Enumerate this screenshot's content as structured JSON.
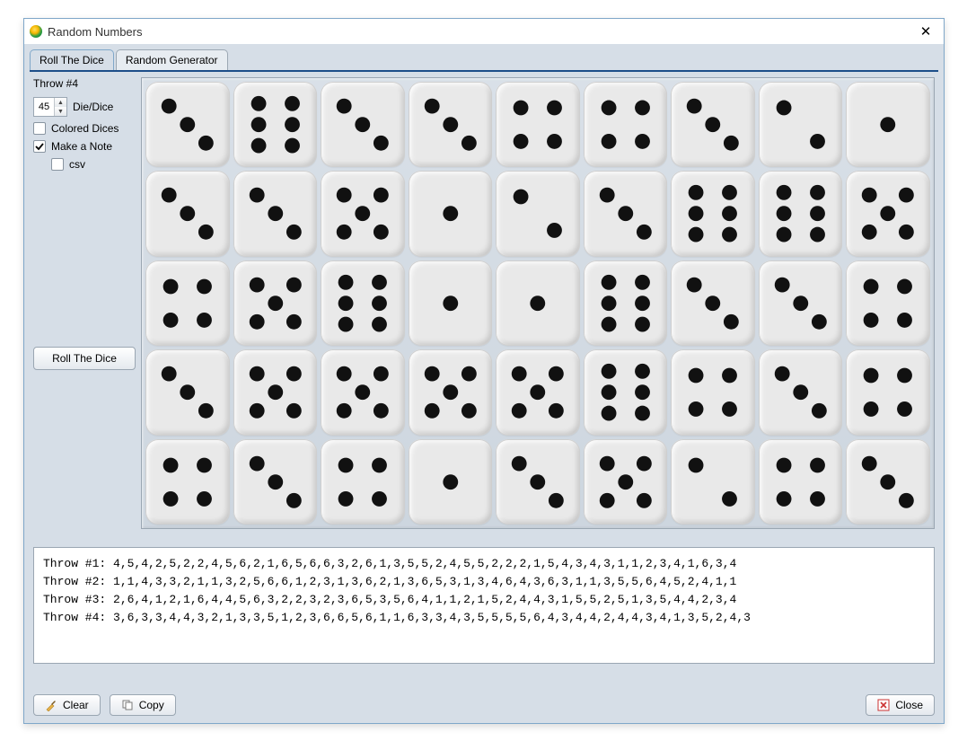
{
  "window": {
    "title": "Random Numbers"
  },
  "tabs": [
    {
      "label": "Roll The Dice",
      "active": true
    },
    {
      "label": "Random Generator",
      "active": false
    }
  ],
  "controls": {
    "throw_label": "Throw #4",
    "die_count": "45",
    "die_count_label": "Die/Dice",
    "colored_dices_label": "Colored Dices",
    "colored_dices_checked": false,
    "make_note_label": "Make a Note",
    "make_note_checked": true,
    "csv_label": "csv",
    "csv_checked": false,
    "roll_button": "Roll The Dice"
  },
  "dice": [
    3,
    6,
    3,
    3,
    4,
    4,
    3,
    2,
    1,
    3,
    3,
    5,
    1,
    2,
    3,
    6,
    6,
    5,
    4,
    5,
    6,
    1,
    1,
    6,
    3,
    3,
    4,
    3,
    5,
    5,
    5,
    5,
    6,
    4,
    3,
    4,
    4,
    3,
    4,
    1,
    3,
    5,
    2,
    4,
    3
  ],
  "log": [
    "Throw #1: 4,5,4,2,5,2,2,4,5,6,2,1,6,5,6,6,3,2,6,1,3,5,5,2,4,5,5,2,2,2,1,5,4,3,4,3,1,1,2,3,4,1,6,3,4",
    "Throw #2: 1,1,4,3,3,2,1,1,3,2,5,6,6,1,2,3,1,3,6,2,1,3,6,5,3,1,3,4,6,4,3,6,3,1,1,3,5,5,6,4,5,2,4,1,1",
    "Throw #3: 2,6,4,1,2,1,6,4,4,5,6,3,2,2,3,2,3,6,5,3,5,6,4,1,1,2,1,5,2,4,4,3,1,5,5,2,5,1,3,5,4,4,2,3,4",
    "Throw #4: 3,6,3,3,4,4,3,2,1,3,3,5,1,2,3,6,6,5,6,1,1,6,3,3,4,3,5,5,5,5,6,4,3,4,4,2,4,4,3,4,1,3,5,2,4,3"
  ],
  "footer": {
    "clear": "Clear",
    "copy": "Copy",
    "close": "Close"
  }
}
